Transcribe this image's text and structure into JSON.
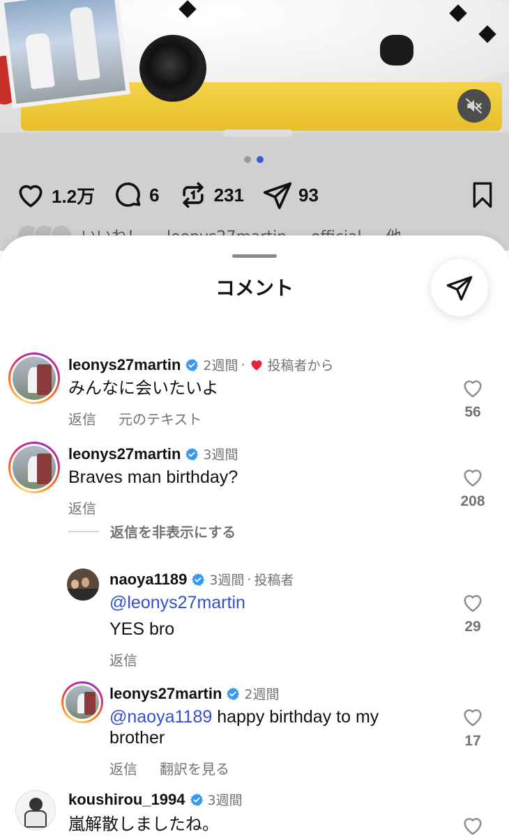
{
  "post": {
    "likes": "1.2万",
    "comments": "6",
    "reposts": "231",
    "shares": "93",
    "carousel_pages": 2,
    "carousel_active_index": 1,
    "likes_preview_text": "いいね！ ... leonys27martin ... official ... 他"
  },
  "sheet": {
    "title": "コメント"
  },
  "comments": [
    {
      "username": "leonys27martin",
      "time": "2週間",
      "separator": "·",
      "badge": "投稿者から",
      "text": "みんなに会いたいよ",
      "reply_label": "返信",
      "extra_action": "元のテキスト",
      "like_count": "56"
    },
    {
      "username": "leonys27martin",
      "time": "3週間",
      "text": "Braves man birthday?",
      "reply_label": "返信",
      "like_count": "208",
      "hide_replies": "返信を非表示にする"
    },
    {
      "username": "naoya1189",
      "time": "3週間",
      "separator": "·",
      "badge": "投稿者",
      "mention": "@leonys27martin",
      "text": "YES bro",
      "reply_label": "返信",
      "like_count": "29"
    },
    {
      "username": "leonys27martin",
      "time": "2週間",
      "mention": "@naoya1189",
      "text_line1": " happy birthday to my",
      "text_line2": "brother",
      "reply_label": "返信",
      "extra_action": "翻訳を見る",
      "like_count": "17"
    },
    {
      "username": "koushirou_1994",
      "time": "3週間",
      "text": "嵐解散しましたね。"
    }
  ],
  "colors": {
    "verified": "#3897f0",
    "mention": "#3450c8",
    "heart_red": "#e8233a",
    "carousel_active": "#3b5bd6"
  }
}
